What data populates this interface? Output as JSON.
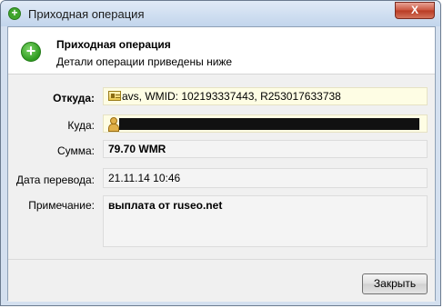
{
  "window": {
    "title": "Приходная операция",
    "close_label": "X"
  },
  "header": {
    "title": "Приходная операция",
    "subtitle": "Детали операции приведены ниже",
    "icon": "plus-circle-icon"
  },
  "fields": {
    "from": {
      "label": "Откуда:",
      "value": "avs, WMID: 102193337443, R253017633738",
      "icon": "id-card-icon"
    },
    "to": {
      "label": "Куда:",
      "value": "",
      "icon": "user-icon"
    },
    "amount": {
      "label": "Сумма:",
      "value": "79.70 WMR"
    },
    "date": {
      "label": "Дата перевода:",
      "value": "21.11.14 10:46"
    },
    "note": {
      "label": "Примечание:",
      "value": "выплата от ruseo.net"
    }
  },
  "footer": {
    "close_button": "Закрыть"
  },
  "colors": {
    "accent_green": "#3fa52c",
    "close_red": "#c9543d",
    "highlight_yellow": "#fefde4"
  }
}
